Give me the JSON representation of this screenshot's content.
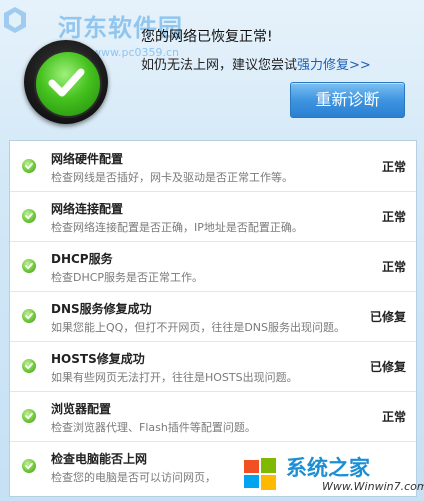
{
  "header": {
    "watermark": "河东软件园",
    "watermark_sub": "www.pc0359.cn",
    "headline": "您的网络已恢复正常!",
    "subline_prefix": "如仍无法上网，建议您尝试",
    "subline_link": "强力修复>>",
    "rediagnose_button": "重新诊断"
  },
  "checks": [
    {
      "title": "网络硬件配置",
      "desc": "检查网线是否插好，网卡及驱动是否正常工作等。",
      "status": "正常"
    },
    {
      "title": "网络连接配置",
      "desc": "检查网络连接配置是否正确，IP地址是否配置正确。",
      "status": "正常"
    },
    {
      "title": "DHCP服务",
      "desc": "检查DHCP服务是否正常工作。",
      "status": "正常"
    },
    {
      "title": "DNS服务修复成功",
      "desc": "如果您能上QQ，但打不开网页，往往是DNS服务出现问题。",
      "status": "已修复"
    },
    {
      "title": "HOSTS修复成功",
      "desc": "如果有些网页无法打开，往往是HOSTS出现问题。",
      "status": "已修复"
    },
    {
      "title": "浏览器配置",
      "desc": "检查浏览器代理、Flash插件等配置问题。",
      "status": "正常"
    },
    {
      "title": "检查电脑能否上网",
      "desc": "检查您的电脑是否可以访问网页，",
      "status": ""
    }
  ],
  "corner_watermark": {
    "name": "系统之家",
    "url": "Www.Winwin7.com"
  },
  "colors": {
    "link": "#1f5fb4",
    "button": "#3f95e0",
    "ok_green": "#6fc83a"
  }
}
